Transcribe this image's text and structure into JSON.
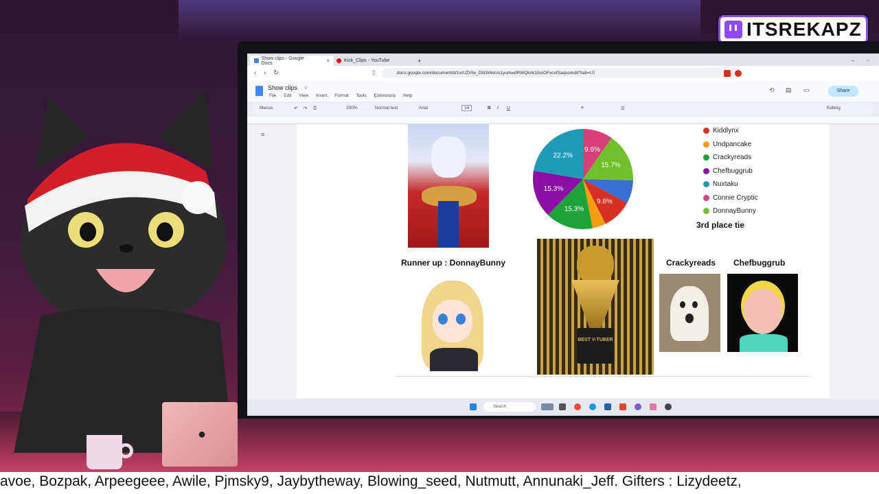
{
  "overlay": {
    "brand": "ITSREKAPZ",
    "ticker": "avoe, Bozpak, Arpeegeee, Awile, Pjmsky9, Jaybytheway, Blowing_seed, Nutmutt, Annunaki_Jeff. Gifters : Lizydeetz,"
  },
  "browser": {
    "tabs": [
      {
        "label": "Show clips - Google Docs",
        "active": true,
        "color": "#4285f4"
      },
      {
        "label": "Kick_Clips - YouTube",
        "active": false,
        "color": "#ff0000"
      }
    ],
    "new_tab": "+",
    "url": "docs.google.com/document/d/1vrUZVlw_DbIW4oUo1yumwdRWQknk15srOFxcxfSaqso/edit?tab=t.0"
  },
  "docs": {
    "title": "Show clips",
    "menus": [
      "File",
      "Edit",
      "View",
      "Insert",
      "Format",
      "Tools",
      "Extensions",
      "Help"
    ],
    "share_label": "Share",
    "toolbar": {
      "search": "Menus",
      "zoom": "200%",
      "style": "Normal text",
      "font": "Arial",
      "size": "14",
      "bold": "B",
      "italic": "I",
      "underline": "U",
      "mode": "Editing"
    }
  },
  "content": {
    "legend": [
      {
        "label": "Kiddlynx",
        "color": "#d93025"
      },
      {
        "label": "Undpancake",
        "color": "#f59c11"
      },
      {
        "label": "Crackyreads",
        "color": "#1ea33a"
      },
      {
        "label": "Chefbuggrub",
        "color": "#8b0fa3"
      },
      {
        "label": "Nuxtaku",
        "color": "#1f9bb8"
      },
      {
        "label": "Connie Cryptic",
        "color": "#d8407a"
      },
      {
        "label": "DonnayBunny",
        "color": "#6fc02a"
      }
    ],
    "third_place": "3rd place tie",
    "runner_up": "Runner up : DonnayBunny",
    "crackyreads_label": "Crackyreads",
    "chefbuggrub_label": "Chefbuggrub",
    "trophy_text": "BEST V-TUBER"
  },
  "chart_data": {
    "type": "pie",
    "slices": [
      {
        "name": "Connie Cryptic",
        "value": 9.6,
        "color": "#d8407a"
      },
      {
        "name": "DonnayBunny",
        "value": 15.7,
        "color": "#6fc02a"
      },
      {
        "name": "Blue",
        "value": 7.5,
        "color": "#3a6fd1"
      },
      {
        "name": "Kiddlynx",
        "value": 9.6,
        "color": "#d93025"
      },
      {
        "name": "Undpancake",
        "value": 4.3,
        "color": "#f59c11"
      },
      {
        "name": "Crackyreads",
        "value": 15.3,
        "color": "#1ea33a"
      },
      {
        "name": "Chefbuggrub",
        "value": 15.3,
        "color": "#8b0fa3"
      },
      {
        "name": "Nuxtaku",
        "value": 22.2,
        "color": "#1f9bb8"
      }
    ],
    "labels": [
      "9.6%",
      "15.7%",
      "9.6%",
      "15.3%",
      "15.3%",
      "22.2%"
    ]
  },
  "taskbar": {
    "search": "Search"
  }
}
